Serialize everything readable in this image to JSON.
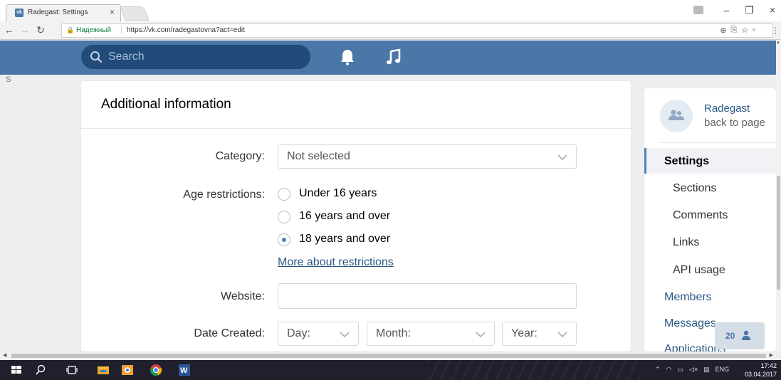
{
  "browser": {
    "tab_title": "Radegast: Settings",
    "tab_close": "×",
    "favicon_text": "vk",
    "secure_label": "Надежный",
    "url": "https://vk.com/radegastovna?act=edit",
    "window_controls": [
      "–",
      "❐",
      "×"
    ]
  },
  "header": {
    "search_placeholder": "Search",
    "icons": [
      "search-icon",
      "bell-icon",
      "music-icon"
    ],
    "brand_color": "#4a76a8"
  },
  "side_letter": "S",
  "form": {
    "title": "Additional information",
    "category_label": "Category:",
    "category_value": "Not selected",
    "age_label": "Age restrictions:",
    "age_options": [
      {
        "label": "Under 16 years",
        "checked": false
      },
      {
        "label": "16 years and over",
        "checked": false
      },
      {
        "label": "18 years and over",
        "checked": true
      }
    ],
    "more_link": "More about restrictions",
    "website_label": "Website:",
    "website_value": "",
    "date_label": "Date Created:",
    "day_placeholder": "Day:",
    "month_placeholder": "Month:",
    "year_placeholder": "Year:"
  },
  "right_panel": {
    "group_name": "Radegast",
    "back_link": "back to page",
    "menu": [
      {
        "label": "Settings",
        "active": true
      },
      {
        "label": "Sections"
      },
      {
        "label": "Comments"
      },
      {
        "label": "Links"
      },
      {
        "label": "API usage"
      },
      {
        "label": "Members"
      },
      {
        "label": "Messages"
      },
      {
        "label": "Applications"
      }
    ]
  },
  "badge": {
    "count": "20"
  },
  "taskbar": {
    "lang": "ENG",
    "time": "17:42",
    "date": "03.04.2017"
  }
}
